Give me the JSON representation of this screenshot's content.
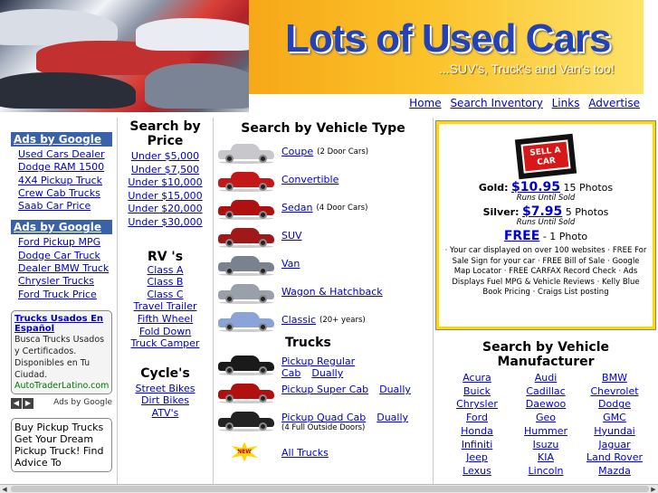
{
  "header": {
    "title": "Lots of Used Cars",
    "tagline": "...SUV's, Truck's and Van's too!",
    "nav": [
      "Home",
      "Search Inventory",
      "Links",
      "Advertise"
    ],
    "accent_color": "#2442b8",
    "banner_color": "#f7a818"
  },
  "ads": {
    "heading1": "Ads by Google",
    "list1": [
      "Used Cars Dealer",
      "Dodge RAM 1500",
      "4X4 Pickup Truck",
      "Crew Cab Trucks",
      "Saab Car Price"
    ],
    "heading2": "Ads by Google",
    "list2": [
      "Ford Pickup MPG",
      "Dodge Car Truck",
      "Dealer BMW Truck",
      "Chrysler Trucks",
      "Ford Truck Price"
    ],
    "box1": {
      "title": "Trucks Usados En Español",
      "body": "Busca Trucks Usados y Certificados. Disponibles en Tu Ciudad.",
      "url": "AutoTraderLatino.com",
      "footer": "Ads by Google"
    },
    "box2": {
      "title": "Buy Pickup Trucks",
      "body": "Get Your Dream Pickup Truck! Find Advice To"
    }
  },
  "price": {
    "title": "Search by Price",
    "items": [
      "Under $5,000",
      "Under $7,500",
      "Under $10,000",
      "Under $15,000",
      "Under $20,000",
      "Under $30,000"
    ],
    "rv_title": "RV 's",
    "rv_items": [
      "Class A",
      "Class B",
      "Class C",
      "Travel Trailer",
      "Fifth Wheel",
      "Fold Down",
      "Truck Camper"
    ],
    "cycle_title": "Cycle's",
    "cycle_items": [
      "Street Bikes",
      "Dirt Bikes",
      "ATV's"
    ]
  },
  "vehicle_types": {
    "title": "Search by Vehicle Type",
    "items": [
      {
        "label": "Coupe",
        "sub": "(2 Door Cars)",
        "icon": "coupe-image",
        "color": "#c8c8cc"
      },
      {
        "label": "Convertible",
        "sub": "",
        "icon": "convertible-image",
        "color": "#c41818"
      },
      {
        "label": "Sedan",
        "sub": "(4 Door Cars)",
        "icon": "sedan-image",
        "color": "#b01010"
      },
      {
        "label": "SUV",
        "sub": "",
        "icon": "suv-image",
        "color": "#a01818"
      },
      {
        "label": "Van",
        "sub": "",
        "icon": "van-image",
        "color": "#7a8290"
      },
      {
        "label": "Wagon & Hatchback",
        "sub": "",
        "icon": "wagon-image",
        "color": "#9aa0aa"
      },
      {
        "label": "Classic",
        "sub": "(20+ years)",
        "icon": "classic-car-image",
        "color": "#8aa4d8"
      }
    ],
    "trucks_title": "Trucks",
    "trucks": [
      {
        "label": "Pickup Regular Cab",
        "link2": "Dually",
        "sub": "",
        "color": "#1a1a1a"
      },
      {
        "label": "Pickup Super Cab",
        "link2": "Dually",
        "sub": "",
        "color": "#b01010"
      },
      {
        "label": "Pickup Quad Cab",
        "link2": "Dually",
        "sub": "(4 Full Outside Doors)",
        "color": "#222222"
      }
    ],
    "all_trucks": "All Trucks",
    "new_badge": "NEW"
  },
  "sell": {
    "sign_text": "SELL A CAR",
    "gold_label": "Gold:",
    "gold_price": "$10.95",
    "gold_photos": "15 Photos",
    "gold_note": "Runs Until Sold",
    "silver_label": "Silver:",
    "silver_price": "$7.95",
    "silver_photos": "5 Photos",
    "silver_note": "Runs Until Sold",
    "free_label": "FREE",
    "free_photos": "- 1 Photo",
    "description": "· Your car displayed on over 100 websites · FREE For Sale Sign for your car · FREE Bill of Sale · Google Map Locator · FREE CARFAX Record Check · Ads Displays Fuel MPG & Vehicle Reviews · Kelly Blue Book Pricing · Craigs List posting"
  },
  "manufacturers": {
    "title": "Search by Vehicle Manufacturer",
    "items": [
      "Acura",
      "Audi",
      "BMW",
      "Buick",
      "Cadillac",
      "Chevrolet",
      "Chrysler",
      "Daewoo",
      "Dodge",
      "Ford",
      "Geo",
      "GMC",
      "Honda",
      "Hummer",
      "Hyundai",
      "Infiniti",
      "Isuzu",
      "Jaguar",
      "Jeep",
      "KIA",
      "Land Rover",
      "Lexus",
      "Lincoln",
      "Mazda"
    ]
  }
}
